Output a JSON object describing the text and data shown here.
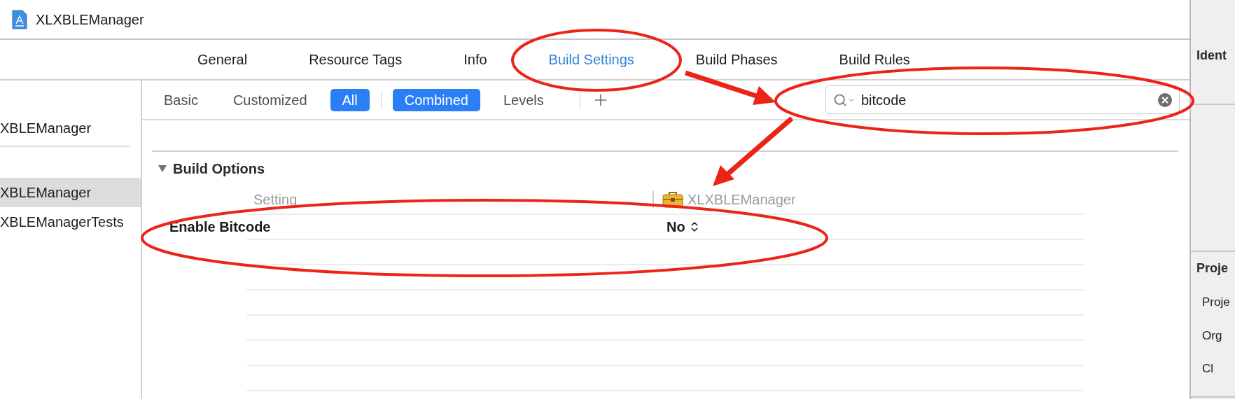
{
  "window": {
    "title": "XLXBLEManager"
  },
  "tabs": [
    {
      "label": "General",
      "selected": false
    },
    {
      "label": "Resource Tags",
      "selected": false
    },
    {
      "label": "Info",
      "selected": false
    },
    {
      "label": "Build Settings",
      "selected": true
    },
    {
      "label": "Build Phases",
      "selected": false
    },
    {
      "label": "Build Rules",
      "selected": false
    }
  ],
  "sidebar": {
    "items": [
      {
        "label": "XBLEManager",
        "kind": "project",
        "selected": false
      },
      {
        "label": "XBLEManager",
        "kind": "target",
        "selected": true
      },
      {
        "label": "XBLEManagerTests",
        "kind": "target",
        "selected": false
      }
    ]
  },
  "filters": [
    {
      "label": "Basic",
      "selected": false
    },
    {
      "label": "Customized",
      "selected": false
    },
    {
      "label": "All",
      "selected": true
    }
  ],
  "views": [
    {
      "label": "Combined",
      "selected": true
    },
    {
      "label": "Levels",
      "selected": false
    }
  ],
  "search": {
    "value": "bitcode"
  },
  "section": {
    "title": "Build Options",
    "expanded": true,
    "columns": [
      "Setting",
      "XLXBLEManager"
    ],
    "rows": [
      {
        "setting": "Enable Bitcode",
        "value": "No"
      }
    ]
  },
  "inspector": {
    "sections": [
      {
        "title": "Ident"
      },
      {
        "title": "Proje",
        "labels": [
          "Proje",
          "Org",
          "Cl"
        ]
      }
    ]
  }
}
